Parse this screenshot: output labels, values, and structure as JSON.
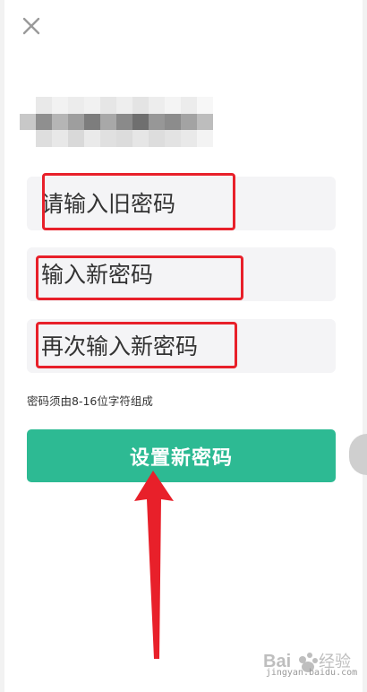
{
  "header": {
    "close_icon": "close-icon"
  },
  "form": {
    "old_password": {
      "value": "",
      "placeholder": "请输入旧密码"
    },
    "new_password": {
      "value": "",
      "placeholder": "输入新密码"
    },
    "confirm_password": {
      "value": "",
      "placeholder": "再次输入新密码"
    },
    "hint": "密码须由8-16位字符组成",
    "submit_label": "设置新密码"
  },
  "colors": {
    "accent": "#2dba93",
    "annotation": "#e8202a",
    "field_bg": "#f4f4f6"
  },
  "watermark": {
    "logo": "baidu-jingyan-logo",
    "url": "jingyan.baidu.com"
  }
}
